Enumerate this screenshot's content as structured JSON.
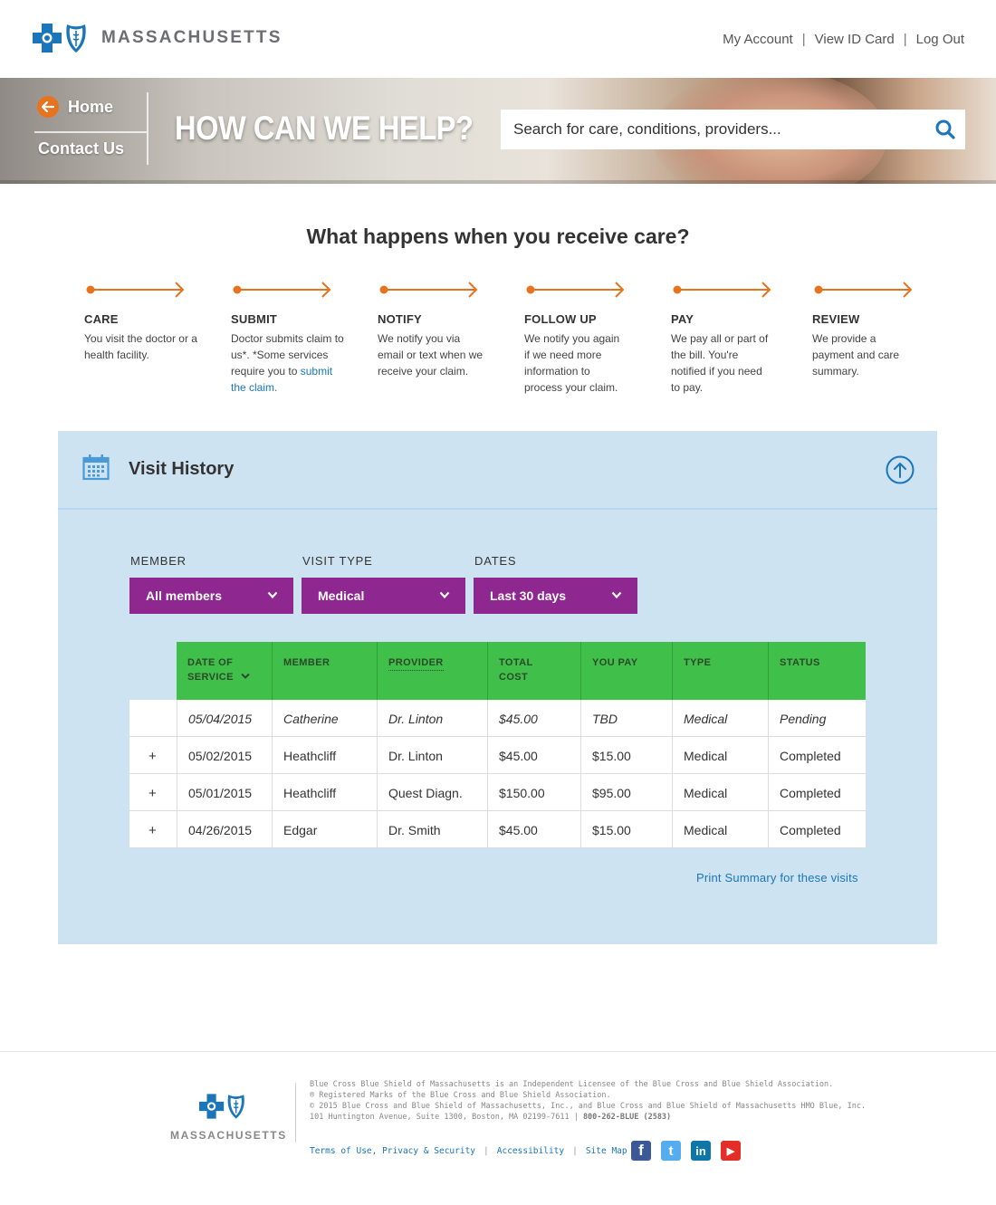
{
  "brand": {
    "logo_text": "MASSACHUSETTS"
  },
  "toplinks": {
    "my_account": "My Account",
    "view_id_card": "View ID Card",
    "log_out": "Log Out",
    "separator": "|"
  },
  "hero": {
    "home": "Home",
    "contact": "Contact Us",
    "title": "HOW CAN WE HELP?",
    "search_placeholder": "Search for care, conditions, providers..."
  },
  "process": {
    "title": "What happens when you receive care?",
    "steps": [
      {
        "label": "CARE",
        "desc": "You visit the doctor or a health facility."
      },
      {
        "label": "SUBMIT",
        "desc": "Doctor submits claim to us*. *Some services require you to ",
        "link": "submit the claim."
      },
      {
        "label": "NOTIFY",
        "desc": "We notify you via email or text when we receive your claim."
      },
      {
        "label": "FOLLOW UP",
        "desc": "We notify you again if we need more information to process your claim."
      },
      {
        "label": "PAY",
        "desc": "We pay all or part of the bill. You're notified if you need to pay."
      },
      {
        "label": "REVIEW",
        "desc": "We provide a payment and care summary."
      }
    ],
    "accent_color": "#e8731f"
  },
  "visit_history": {
    "title": "Visit History",
    "filters": [
      {
        "label": "MEMBER",
        "value": "All members"
      },
      {
        "label": "VISIT TYPE",
        "value": "Medical"
      },
      {
        "label": "DATES",
        "value": "Last 30 days"
      }
    ],
    "columns": [
      "DATE OF",
      "SERVICE",
      "MEMBER",
      "PROVIDER",
      "TOTAL",
      "COST",
      "YOU PAY",
      "TYPE",
      "STATUS"
    ],
    "rows": [
      {
        "expand": "",
        "date": "05/04/2015",
        "member": "Catherine",
        "provider": "Dr. Linton",
        "total": "$45.00",
        "you_pay": "TBD",
        "type": "Medical",
        "status": "Pending"
      },
      {
        "expand": "+",
        "date": "05/02/2015",
        "member": "Heathcliff",
        "provider": "Dr. Linton",
        "total": "$45.00",
        "you_pay": "$15.00",
        "type": "Medical",
        "status": "Completed"
      },
      {
        "expand": "+",
        "date": "05/01/2015",
        "member": "Heathcliff",
        "provider": "Quest Diagn.",
        "total": "$150.00",
        "you_pay": "$95.00",
        "type": "Medical",
        "status": "Completed"
      },
      {
        "expand": "+",
        "date": "04/26/2015",
        "member": "Edgar",
        "provider": "Dr. Smith",
        "total": "$45.00",
        "you_pay": "$15.00",
        "type": "Medical",
        "status": "Completed"
      }
    ],
    "print_link": "Print Summary for these visits",
    "colors": {
      "panel": "#cde3f1",
      "filter": "#8e278f",
      "header": "#40bf4a"
    }
  },
  "footer": {
    "logo_text": "MASSACHUSETTS",
    "line1": "Blue Cross Blue Shield of Massachusetts is an Independent Licensee of the Blue Cross and Blue Shield Association.",
    "line2": "® Registered Marks of the Blue Cross and Blue Shield Association.",
    "line3": "© 2015 Blue Cross and Blue Shield of Massachusetts, Inc., and Blue Cross and Blue Shield of Massachusetts HMO Blue, Inc.",
    "line4": "101 Huntington Avenue, Suite 1300, Boston, MA 02199-7611 | ",
    "phone": "800-262-BLUE (2583)",
    "links": {
      "terms": "Terms of Use, Privacy & Security",
      "accessibility": "Accessibility",
      "sitemap": "Site Map"
    },
    "social": [
      {
        "icon": "facebook-icon",
        "glyph": "f",
        "color": "#3b5998"
      },
      {
        "icon": "twitter-icon",
        "glyph": "t",
        "color": "#55acee"
      },
      {
        "icon": "linkedin-icon",
        "glyph": "in",
        "color": "#0e76a8"
      },
      {
        "icon": "youtube-icon",
        "glyph": "▶",
        "color": "#e52d27"
      }
    ]
  }
}
